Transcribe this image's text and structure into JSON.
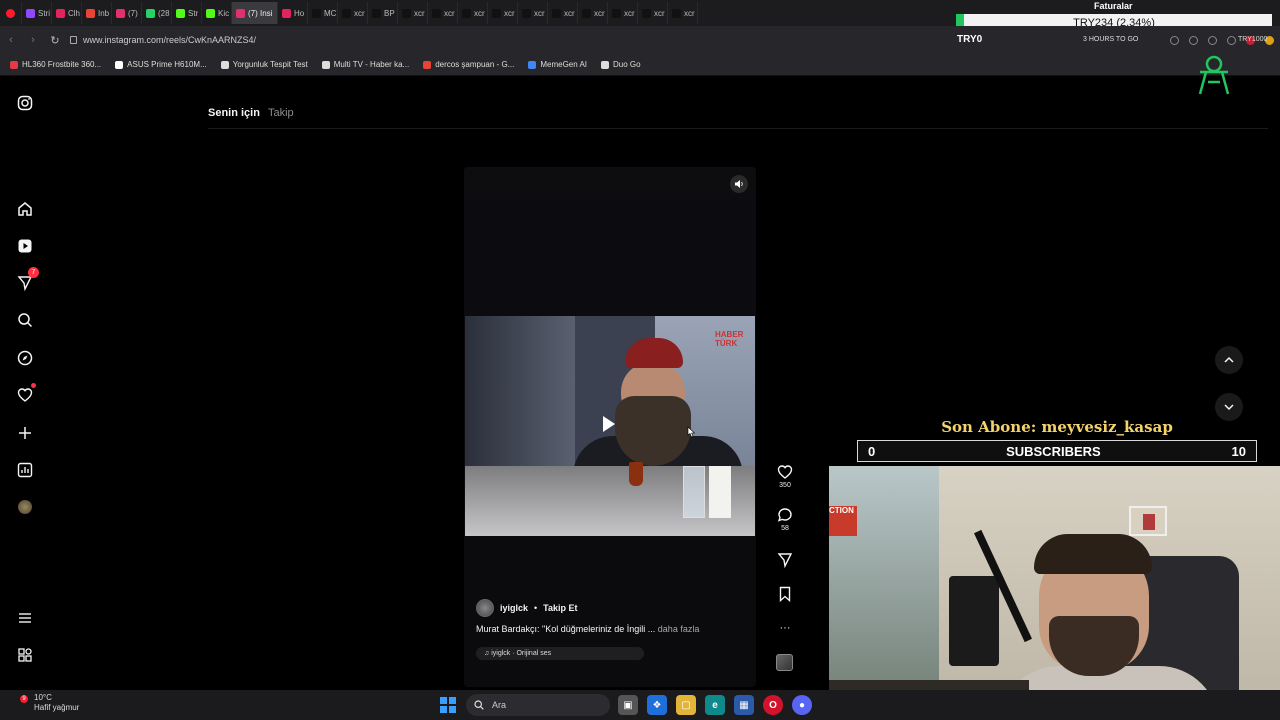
{
  "browser": {
    "tabs": [
      {
        "label": "Stri",
        "color": "#9146ff"
      },
      {
        "label": "Clh",
        "color": "#e0245e"
      },
      {
        "label": "Inb",
        "color": "#ea4335"
      },
      {
        "label": "(7)",
        "color": "#e1306c"
      },
      {
        "label": "(28",
        "color": "#25d366"
      },
      {
        "label": "Str",
        "color": "#53fc18"
      },
      {
        "label": "Kic",
        "color": "#53fc18"
      },
      {
        "label": "(7) Insi",
        "color": "#e1306c",
        "active": true
      },
      {
        "label": "Ho",
        "color": "#e0245e"
      },
      {
        "label": "MC",
        "color": "#111111"
      },
      {
        "label": "xcr",
        "color": "#111111"
      },
      {
        "label": "BP",
        "color": "#111111"
      },
      {
        "label": "xcr",
        "color": "#111111"
      },
      {
        "label": "xcr",
        "color": "#111111"
      },
      {
        "label": "xcr",
        "color": "#111111"
      },
      {
        "label": "xcr",
        "color": "#111111"
      },
      {
        "label": "xcr",
        "color": "#111111"
      },
      {
        "label": "xcr",
        "color": "#111111"
      },
      {
        "label": "xcr",
        "color": "#111111"
      },
      {
        "label": "xcr",
        "color": "#111111"
      },
      {
        "label": "xcr",
        "color": "#111111"
      },
      {
        "label": "xcr",
        "color": "#111111"
      }
    ],
    "url": "www.instagram.com/reels/CwKnAARNZS4/",
    "bookmarks": [
      {
        "label": "HL360 Frostbite 360...",
        "color": "#e63946"
      },
      {
        "label": "ASUS Prime H610M...",
        "color": "#ffffff"
      },
      {
        "label": "Yorgunluk Tespit Test",
        "color": "#dddddd"
      },
      {
        "label": "Multi TV - Haber ka...",
        "color": "#dddddd"
      },
      {
        "label": "dercos şampuan - G...",
        "color": "#ea4335"
      },
      {
        "label": "MemeGen AI",
        "color": "#4285f4"
      },
      {
        "label": "Duo Go",
        "color": "#dddddd"
      }
    ]
  },
  "stock": {
    "title": "Faturalar",
    "change": "TRY234 (2.34%)",
    "symbol": "TRY0",
    "hours": "3 HOURS TO GO",
    "symbol2": "TRY1000"
  },
  "instagram": {
    "feed_tabs": {
      "for_you": "Senin için",
      "following": "Takip"
    },
    "nav_badge": "7",
    "reel": {
      "username": "iyiglck",
      "separator": "•",
      "follow": "Takip Et",
      "caption": "Murat Bardakçı: \"Kol düğmeleriniz de İngili ...",
      "caption_more": "daha fazla",
      "audio": "iyiglck · Orijinal ses",
      "video_logo": "HABER TÜRK",
      "likes": "350",
      "comments": "58"
    }
  },
  "overlay": {
    "last_sub": "Son Abone: meyvesiz_kasap",
    "sub_current": "0",
    "sub_label": "SUBSCRIBERS",
    "sub_goal": "10",
    "webcam_banner": "CTION"
  },
  "taskbar": {
    "weather_temp": "10°C",
    "weather_desc": "Hafif yağmur",
    "weather_badge": "9",
    "search_placeholder": "Ara"
  }
}
